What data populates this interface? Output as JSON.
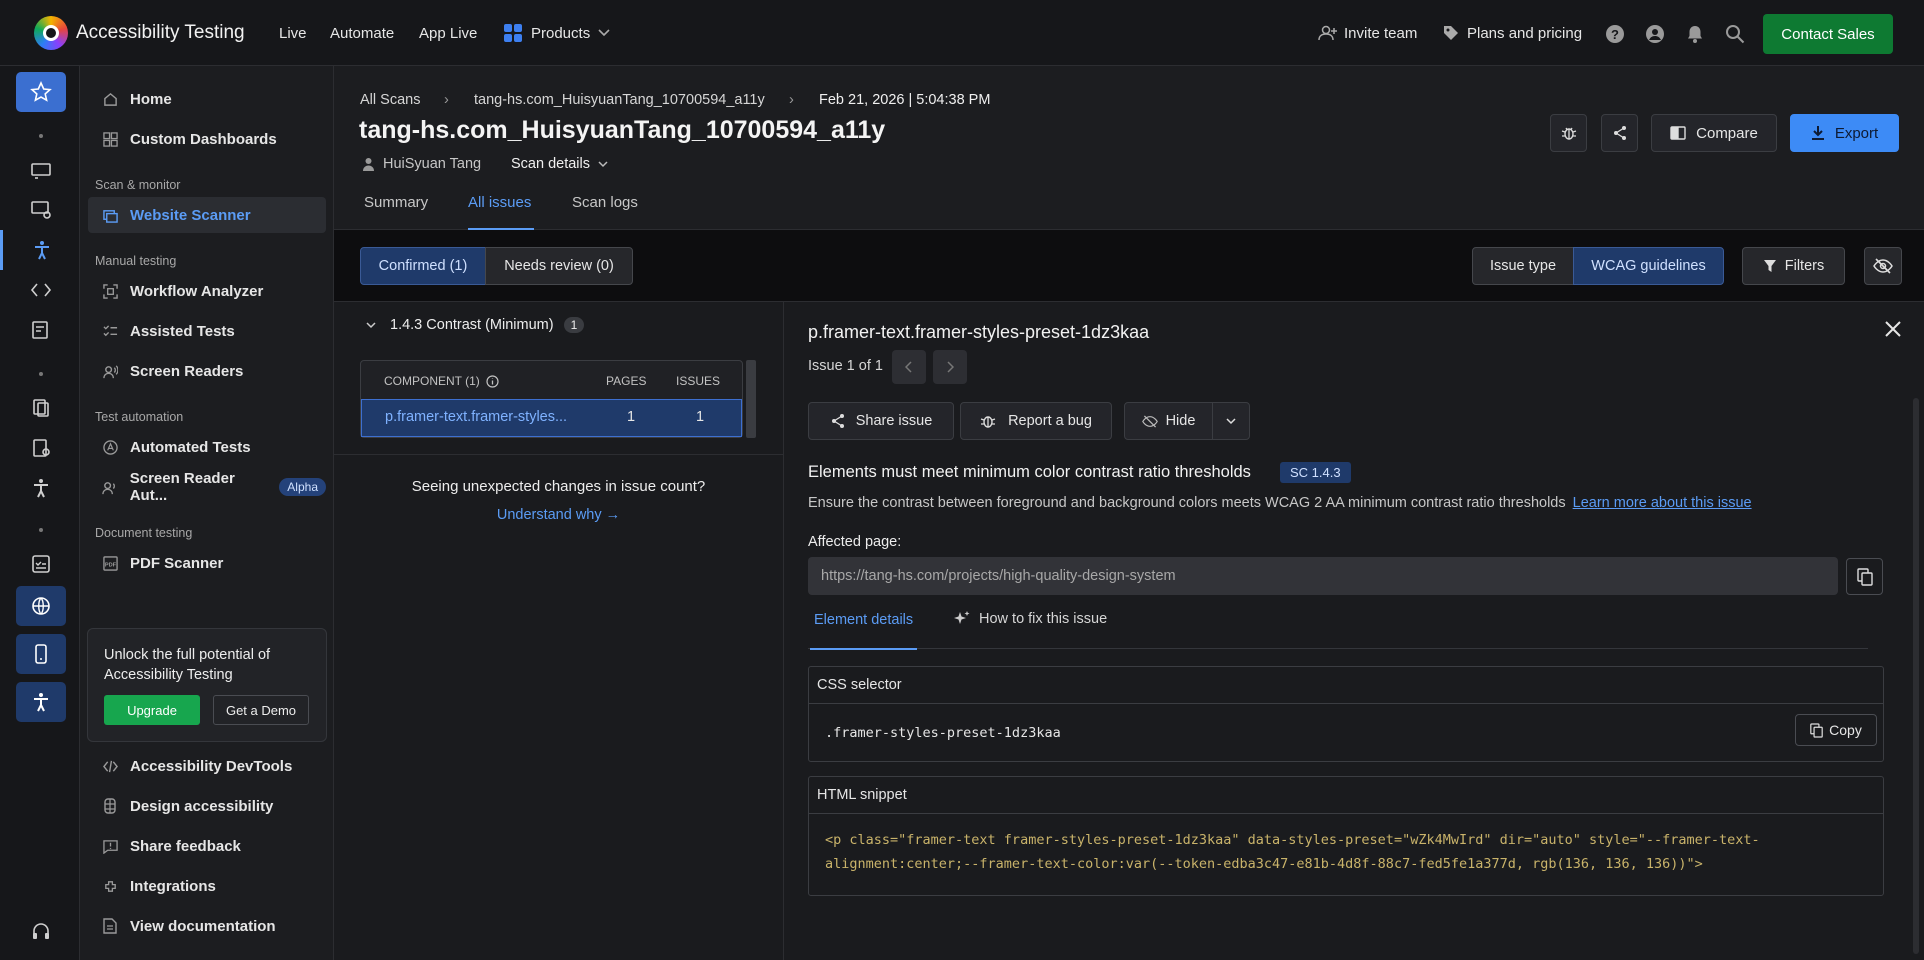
{
  "topbar": {
    "app_title": "Accessibility Testing",
    "nav": [
      "Live",
      "Automate",
      "App Live"
    ],
    "products_label": "Products",
    "invite_label": "Invite team",
    "plans_label": "Plans and pricing",
    "contact_label": "Contact Sales"
  },
  "sidebar": {
    "home": "Home",
    "custom_dashboards": "Custom Dashboards",
    "section_scan": "Scan & monitor",
    "website_scanner": "Website Scanner",
    "section_manual": "Manual testing",
    "workflow_analyzer": "Workflow Analyzer",
    "assisted_tests": "Assisted Tests",
    "screen_readers": "Screen Readers",
    "section_automation": "Test automation",
    "automated_tests": "Automated Tests",
    "screen_reader_auto": "Screen Reader Aut...",
    "alpha_badge": "Alpha",
    "section_document": "Document testing",
    "pdf_scanner": "PDF Scanner",
    "promo_text": "Unlock the full potential of Accessibility Testing",
    "upgrade_label": "Upgrade",
    "demo_label": "Get a Demo",
    "devtools": "Accessibility DevTools",
    "design_accessibility": "Design accessibility",
    "share_feedback": "Share feedback",
    "integrations": "Integrations",
    "view_documentation": "View documentation"
  },
  "header": {
    "breadcrumb": [
      "All Scans",
      "tang-hs.com_HuisyuanTang_10700594_a11y",
      "Feb 21, 2026 | 5:04:38 PM"
    ],
    "title": "tang-hs.com_HuisyuanTang_10700594_a11y",
    "user": "HuiSyuan Tang",
    "scan_details": "Scan details",
    "compare_label": "Compare",
    "export_label": "Export",
    "tabs": [
      "Summary",
      "All issues",
      "Scan logs"
    ],
    "active_tab": "All issues"
  },
  "filters": {
    "confirmed": "Confirmed (1)",
    "needs_review": "Needs review (0)",
    "issue_type": "Issue type",
    "wcag": "WCAG guidelines",
    "filters_label": "Filters"
  },
  "issue_list": {
    "group_title": "1.4.3 Contrast (Minimum)",
    "group_count": "1",
    "col_component": "COMPONENT (1)",
    "col_pages": "PAGES",
    "col_issues": "ISSUES",
    "rows": [
      {
        "component": "p.framer-text.framer-styles...",
        "pages": "1",
        "issues": "1"
      }
    ],
    "unexpected_text": "Seeing unexpected changes in issue count?",
    "understand_link": "Understand why →"
  },
  "detail": {
    "title": "p.framer-text.framer-styles-preset-1dz3kaa",
    "issue_counter": "Issue 1 of 1",
    "share_issue": "Share issue",
    "report_bug": "Report a bug",
    "hide_label": "Hide",
    "rule_title": "Elements must meet minimum color contrast ratio thresholds",
    "sc_badge": "SC 1.4.3",
    "rule_desc": "Ensure the contrast between foreground and background colors meets WCAG 2 AA minimum contrast ratio thresholds",
    "learn_more": "Learn more about this issue",
    "affected_label": "Affected page:",
    "affected_url": "https://tang-hs.com/projects/high-quality-design-system",
    "tab_element": "Element details",
    "tab_fix": "How to fix this issue",
    "css_label": "CSS selector",
    "css_value": ".framer-styles-preset-1dz3kaa",
    "copy_label": "Copy",
    "html_label": "HTML snippet",
    "html_line1": "<p class=\"framer-text framer-styles-preset-1dz3kaa\" data-styles-preset=\"wZk4MwIrd\" dir=\"auto\" style=\"--framer-text-",
    "html_line2": "alignment:center;--framer-text-color:var(--token-edba3c47-e81b-4d8f-88c7-fed5fe1a377d, rgb(136, 136, 136))\">"
  },
  "colors": {
    "accent": "#5b9cf5",
    "brand_green": "#0e7a32",
    "active_bg": "#1f3a6a"
  }
}
